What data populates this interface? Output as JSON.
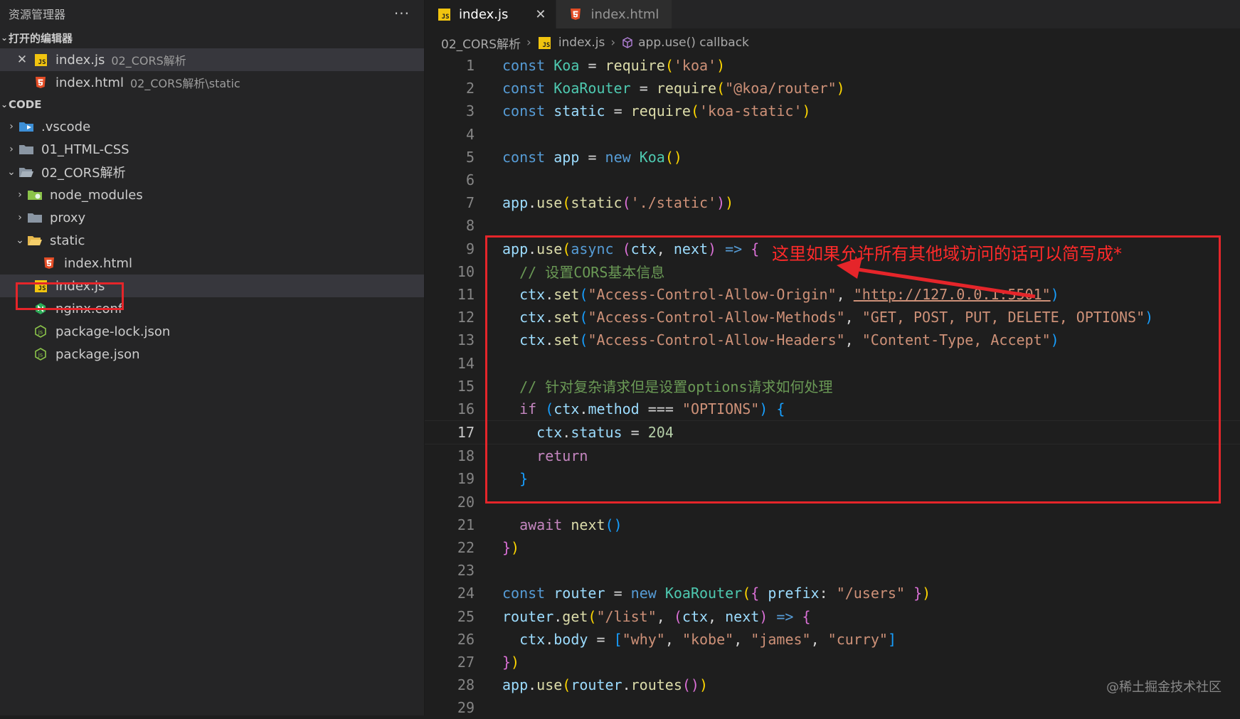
{
  "sidebar": {
    "title": "资源管理器",
    "more": "···",
    "open_editors": {
      "label": "打开的编辑器",
      "items": [
        {
          "name": "index.js",
          "desc": "02_CORS解析",
          "close": "✕"
        },
        {
          "name": "index.html",
          "desc": "02_CORS解析\\static"
        }
      ]
    },
    "workspace": {
      "label": "CODE",
      "items": [
        {
          "name": ".vscode"
        },
        {
          "name": "01_HTML-CSS"
        },
        {
          "name": "02_CORS解析"
        },
        {
          "name": "node_modules"
        },
        {
          "name": "proxy"
        },
        {
          "name": "static"
        },
        {
          "name": "index.html"
        },
        {
          "name": "index.js"
        },
        {
          "name": "nginx.conf"
        },
        {
          "name": "package-lock.json"
        },
        {
          "name": "package.json"
        }
      ]
    }
  },
  "tabs": [
    {
      "label": "index.js",
      "close": "✕"
    },
    {
      "label": "index.html"
    }
  ],
  "breadcrumb": [
    "02_CORS解析",
    "index.js",
    "app.use() callback"
  ],
  "line_numbers": [
    "1",
    "2",
    "3",
    "4",
    "5",
    "6",
    "7",
    "8",
    "9",
    "10",
    "11",
    "12",
    "13",
    "14",
    "15",
    "16",
    "17",
    "18",
    "19",
    "20",
    "21",
    "22",
    "23",
    "24",
    "25",
    "26",
    "27",
    "28",
    "29"
  ],
  "annotation": "这里如果允许所有其他域访问的话可以简写成*",
  "watermark": "@稀土掘金技术社区",
  "colors": {
    "keyword": "#569cd6",
    "string": "#ce9178",
    "comment": "#6a9955",
    "annotation": "#e5252a"
  }
}
